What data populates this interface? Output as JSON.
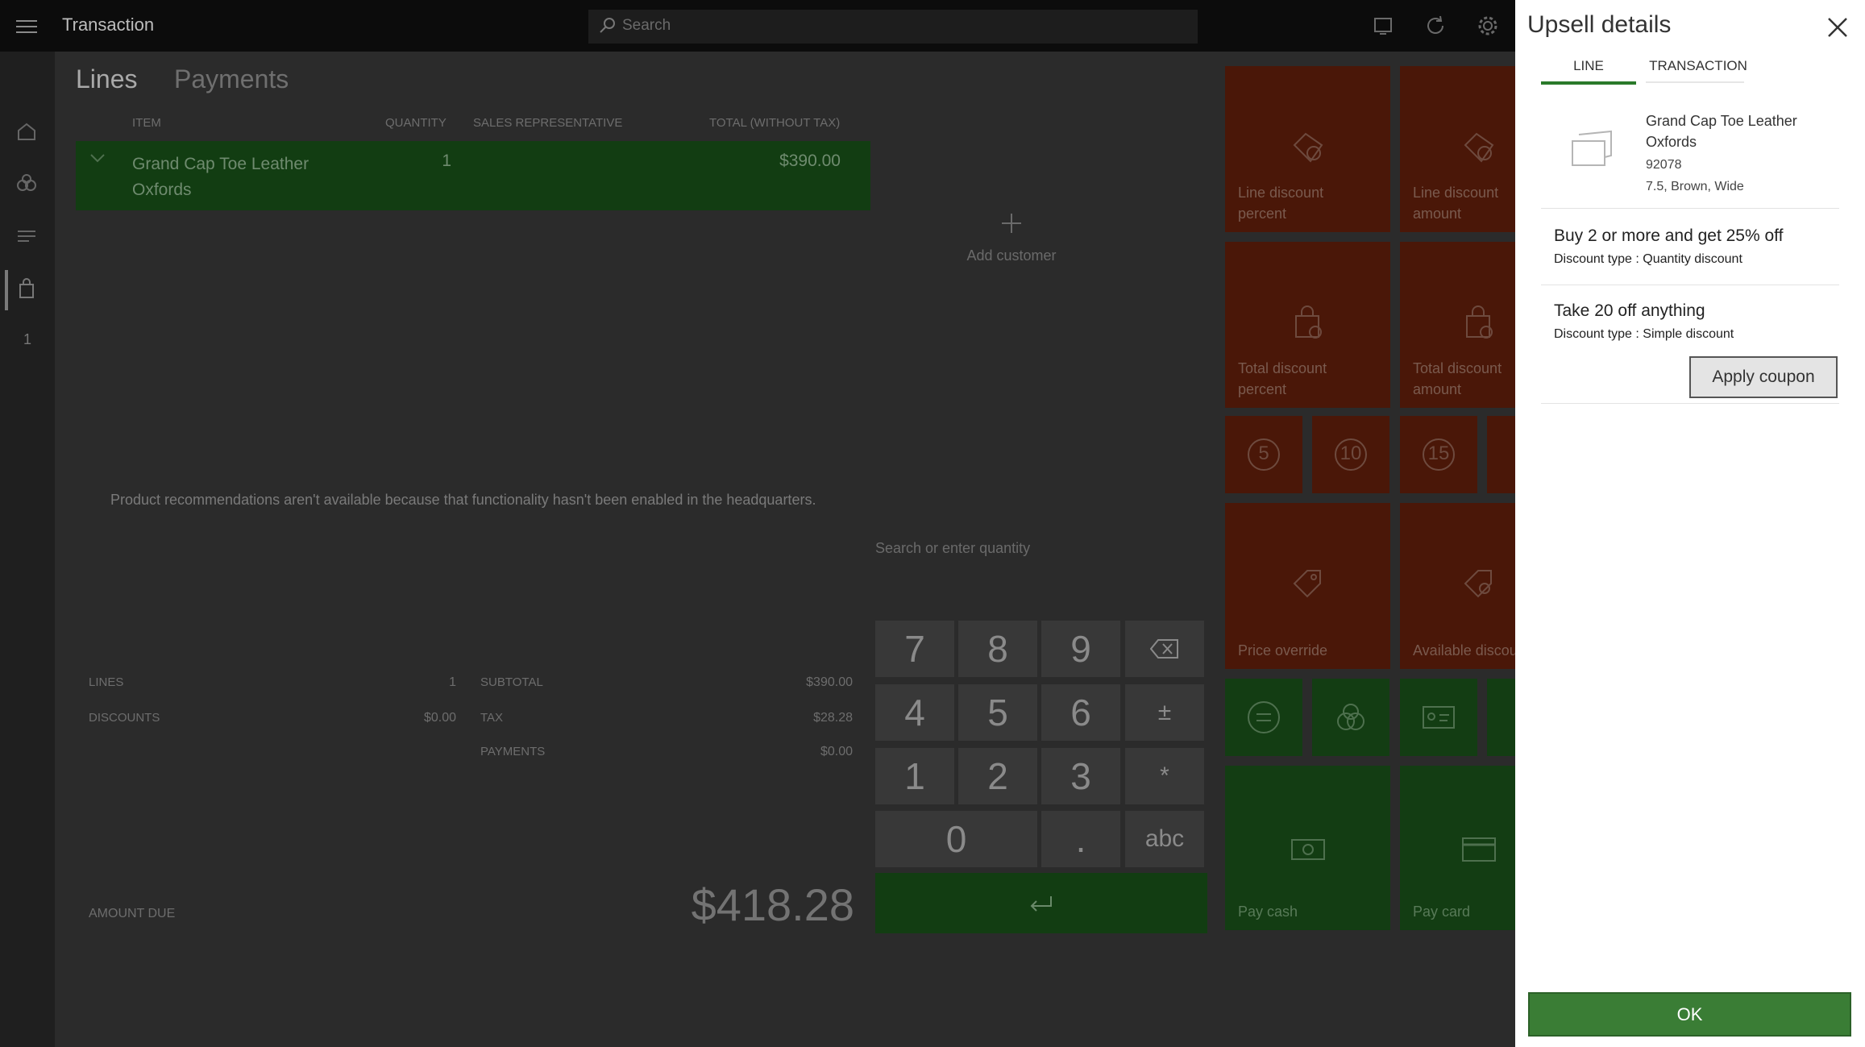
{
  "app": {
    "title": "Transaction",
    "search_placeholder": "Search"
  },
  "left_rail": {
    "cart_count": "1"
  },
  "main": {
    "tabs": [
      "Lines",
      "Payments"
    ],
    "columns": [
      "ITEM",
      "QUANTITY",
      "SALES REPRESENTATIVE",
      "TOTAL (WITHOUT TAX)"
    ],
    "line": {
      "name": "Grand Cap Toe Leather Oxfords",
      "quantity": "1",
      "total": "$390.00"
    },
    "add_customer": "Add customer",
    "recommendation_message": "Product recommendations aren't available because that functionality hasn't been enabled in the headquarters.",
    "quantity_placeholder": "Search or enter quantity",
    "summary": {
      "lines_label": "LINES",
      "lines_value": "1",
      "discounts_label": "DISCOUNTS",
      "discounts_value": "$0.00",
      "subtotal_label": "SUBTOTAL",
      "subtotal_value": "$390.00",
      "tax_label": "TAX",
      "tax_value": "$28.28",
      "payments_label": "PAYMENTS",
      "payments_value": "$0.00",
      "amount_due_label": "AMOUNT DUE",
      "amount_due_value": "$418.28"
    }
  },
  "numpad": {
    "keys": [
      "7",
      "8",
      "9",
      "4",
      "5",
      "6",
      "±",
      "1",
      "2",
      "3",
      "*",
      "0",
      ".",
      "abc"
    ],
    "enter_icon": "enter-arrow-icon"
  },
  "tiles": {
    "line_discount_percent": "Line discount percent",
    "line_discount_amount": "Line discount amount",
    "total_discount_percent": "Total discount percent",
    "total_discount_amount": "Total discount amount",
    "quick_5": "5",
    "quick_10": "10",
    "quick_15": "15",
    "price_override": "Price override",
    "available_discounts": "Available discou",
    "pay_cash": "Pay cash",
    "pay_card": "Pay card"
  },
  "colors": {
    "accent_green": "#3a7d35",
    "tile_red": "#4a1708",
    "tile_green": "#133d13"
  },
  "panel": {
    "title": "Upsell details",
    "tabs": [
      "LINE",
      "TRANSACTION"
    ],
    "active_tab": "LINE",
    "product": {
      "name": "Grand Cap Toe Leather Oxfords",
      "number": "92078",
      "variant": "7.5, Brown, Wide"
    },
    "discounts": [
      {
        "title": "Buy 2 or more and get 25% off",
        "type": "Discount type : Quantity discount"
      },
      {
        "title": "Take 20 off anything",
        "type": "Discount type : Simple discount"
      }
    ],
    "apply_coupon": "Apply coupon",
    "ok": "OK"
  }
}
